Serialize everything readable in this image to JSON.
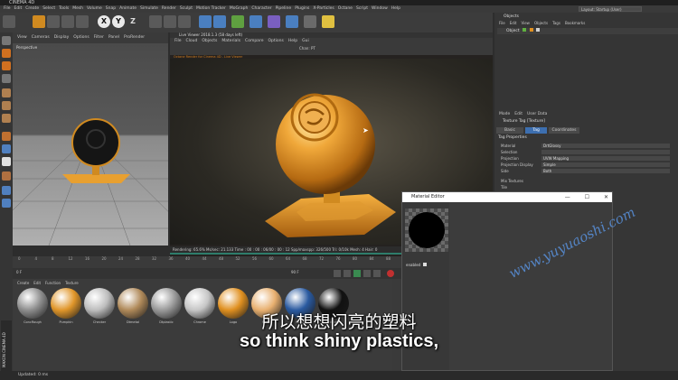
{
  "app": {
    "title": "CINEMA 4D"
  },
  "menubar": {
    "items": [
      "File",
      "Edit",
      "Create",
      "Select",
      "Tools",
      "Mesh",
      "Volume",
      "Snap",
      "Animate",
      "Simulate",
      "Render",
      "Sculpt",
      "Motion Tracker",
      "MoGraph",
      "Character",
      "Pipeline",
      "Plugins",
      "X-Particles",
      "Octane",
      "Script",
      "Window",
      "Help"
    ],
    "layout_label": "Layout:",
    "layout_value": "Startup (User)"
  },
  "toolbar": {
    "x": "X",
    "y": "Y",
    "z": "Z"
  },
  "viewport": {
    "menu": [
      "View",
      "Cameras",
      "Display",
      "Options",
      "Filter",
      "Panel",
      "ProRender"
    ],
    "label": "Perspective"
  },
  "irv": {
    "title": "Live Viewer 2018.1.3 (58 days left)",
    "menu": [
      "File",
      "Cloud",
      "Objects",
      "Materials",
      "Compare",
      "Options",
      "Help",
      "Gui"
    ],
    "camera_label": "Chan:",
    "camera_value": "PT",
    "orange_text": "Octane Render for Cinema 4D  -  Live Viewer",
    "status": "Rendering: 65.6%    Ms/sec: 21.133    Time : 00 : 00 : 06/00 : 00 : 12    Spp/maxspp: 326/500    Tri: 0/10k    Mesh: 4    Hair: 0"
  },
  "objects": {
    "title": "Objects",
    "menu": [
      "File",
      "Edit",
      "View",
      "Objects",
      "Tags",
      "Bookmarks"
    ],
    "row": "Object"
  },
  "attributes": {
    "menu": [
      "Mode",
      "Edit",
      "User Data"
    ],
    "title": "Texture Tag [Texture]",
    "tabs": [
      "Basic",
      "Tag",
      "Coordinates"
    ],
    "section": "Tag Properties",
    "rows": [
      {
        "label": "Material",
        "value": "DrtGlossy"
      },
      {
        "label": "Selection",
        "value": ""
      },
      {
        "label": "Projection",
        "value": "UVW Mapping"
      },
      {
        "label": "Projection Display",
        "value": "Simple"
      },
      {
        "label": "Side",
        "value": "Both"
      },
      {
        "label": "Mix Textures",
        "value": ""
      },
      {
        "label": "Tile",
        "value": ""
      }
    ]
  },
  "timeline": {
    "ticks": [
      "0",
      "4",
      "8",
      "12",
      "16",
      "20",
      "24",
      "28",
      "32",
      "36",
      "40",
      "44",
      "48",
      "52",
      "56",
      "60",
      "64",
      "68",
      "72",
      "76",
      "80",
      "84",
      "88"
    ],
    "start_frame": "0 F",
    "end_frame": "90 F"
  },
  "material_manager": {
    "menu": [
      "Create",
      "Edit",
      "Function",
      "Texture"
    ],
    "materials": [
      {
        "name": "ConcRough",
        "color": "#8e8e8e"
      },
      {
        "name": "Pumpkin",
        "color": "#e0962a"
      },
      {
        "name": "Checker",
        "color": "#bdbdbd"
      },
      {
        "name": "Dtmetal",
        "color": "#b08a5a"
      },
      {
        "name": "Dtplastic",
        "color": "#9a9a9a"
      },
      {
        "name": "Chrome",
        "color": "#c6c6c6"
      },
      {
        "name": "Logo",
        "color": "#e09020"
      },
      {
        "name": "Stripe",
        "color": "#e8b070"
      },
      {
        "name": "Glass",
        "color": "#2a5aa0"
      },
      {
        "name": "DrtGlossy",
        "color": "#111111"
      }
    ]
  },
  "material_editor": {
    "title": "Material Editor",
    "enabled_label": "enabled"
  },
  "bottom_status": "Updated: 0 ms",
  "maxon": "MAXON CINEMA 4D",
  "watermark": "www.yuyuaoshi.com",
  "subtitles": {
    "cn": "所以想想闪亮的塑料",
    "en": "so think shiny plastics,"
  },
  "colors": {
    "accent": "#3d6fb0",
    "orange": "#e0962a",
    "progress": "#2e7d6b"
  }
}
